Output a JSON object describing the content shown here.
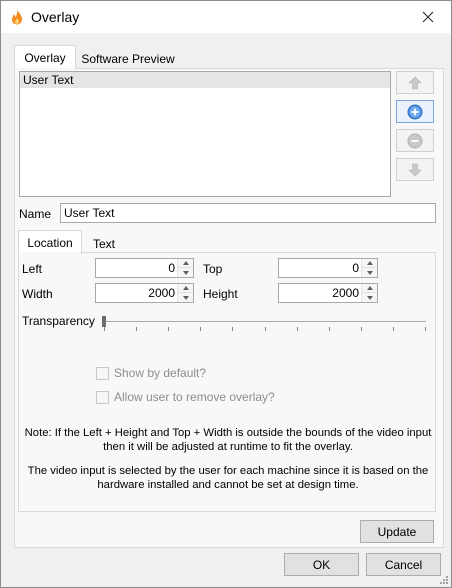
{
  "window": {
    "title": "Overlay"
  },
  "tabs": [
    {
      "label": "Overlay"
    },
    {
      "label": "Software Preview"
    }
  ],
  "overlay_list": {
    "items": [
      "User Text"
    ]
  },
  "name_field": {
    "label": "Name",
    "value": "User Text"
  },
  "inner_tabs": [
    {
      "label": "Location"
    },
    {
      "label": "Text"
    }
  ],
  "location": {
    "left_label": "Left",
    "left_value": "0",
    "top_label": "Top",
    "top_value": "0",
    "width_label": "Width",
    "width_value": "2000",
    "height_label": "Height",
    "height_value": "2000",
    "transparency_label": "Transparency",
    "transparency_value": 0,
    "show_by_default_label": "Show by default?",
    "allow_remove_label": "Allow user to remove overlay?",
    "note1": "Note: If the Left + Height and Top + Width is outside the bounds of the video input then it will be adjusted at runtime to fit the overlay.",
    "note2": "The video input is selected by the user for each machine since it is based on the hardware installed and cannot be set at design time."
  },
  "buttons": {
    "update": "Update",
    "ok": "OK",
    "cancel": "Cancel"
  },
  "icons": {
    "app": "flame-icon",
    "close": "close-icon",
    "move_up": "arrow-up-icon",
    "add": "plus-circle-icon",
    "remove": "minus-circle-icon",
    "move_down": "arrow-down-icon"
  },
  "colors": {
    "accent": "#3c7fd4",
    "app_icon": "#f28c1c"
  }
}
